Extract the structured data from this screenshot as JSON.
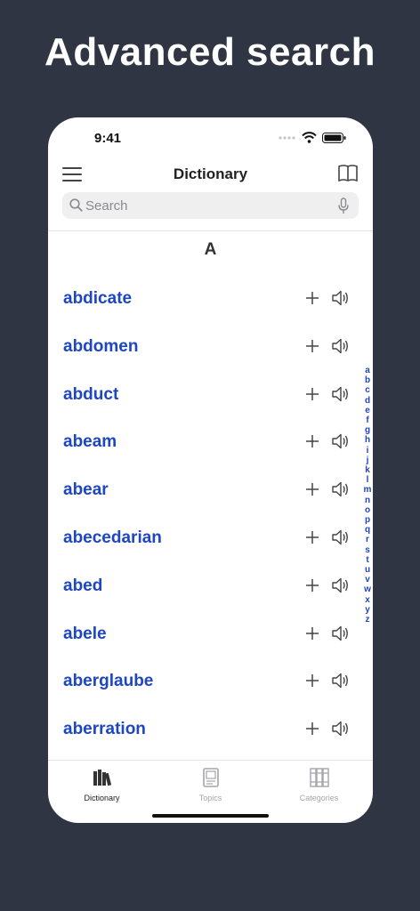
{
  "headline": "Advanced search",
  "status": {
    "time": "9:41"
  },
  "nav": {
    "title": "Dictionary"
  },
  "search": {
    "placeholder": "Search"
  },
  "section": "A",
  "words": [
    "abdicate",
    "abdomen",
    "abduct",
    "abeam",
    "abear",
    "abecedarian",
    "abed",
    "abele",
    "aberglaube",
    "aberration"
  ],
  "index_letters": [
    "a",
    "b",
    "c",
    "d",
    "e",
    "f",
    "g",
    "h",
    "i",
    "j",
    "k",
    "l",
    "m",
    "n",
    "o",
    "p",
    "q",
    "r",
    "s",
    "t",
    "u",
    "v",
    "w",
    "x",
    "y",
    "z"
  ],
  "tabs": [
    {
      "label": "Dictionary",
      "active": true
    },
    {
      "label": "Topics",
      "active": false
    },
    {
      "label": "Categories",
      "active": false
    }
  ],
  "colors": {
    "accent": "#1d46c1",
    "background": "#2f3542"
  }
}
